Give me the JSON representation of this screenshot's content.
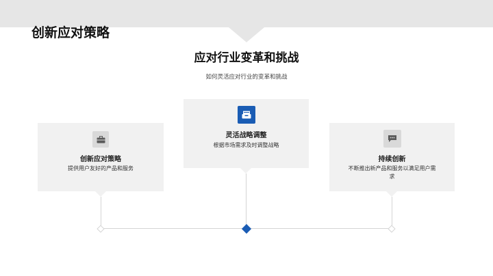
{
  "slide_title": "创新应对策略",
  "main_title": "应对行业变革和挑战",
  "subtitle": "如何灵活应对行业的变革和挑战",
  "colors": {
    "accent": "#1a5cb4",
    "card_bg": "#f1f1f1",
    "band": "#e6e6e6"
  },
  "cards": [
    {
      "title": "创新应对策略",
      "desc": "提供用户友好的产品和服务",
      "icon": "briefcase-icon"
    },
    {
      "title": "灵活战略调整",
      "desc": "根据市场需求及时调整战略",
      "icon": "inbox-tray-icon"
    },
    {
      "title": "持续创新",
      "desc": "不断推出新产品和服务以满足用户需求",
      "icon": "chat-bubble-icon"
    }
  ]
}
